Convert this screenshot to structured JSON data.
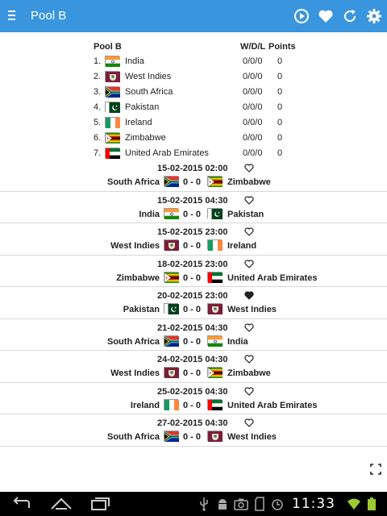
{
  "app_bar": {
    "title": "Pool B",
    "icons": [
      "menu-icon",
      "play-circle-icon",
      "heart-icon",
      "refresh-icon",
      "gear-icon"
    ],
    "color": "#3a95df"
  },
  "standings": {
    "headers": {
      "pool": "Pool B",
      "wdl": "W/D/L",
      "points": "Points"
    },
    "rows": [
      {
        "pos": "1.",
        "team": "India",
        "flag": "india",
        "wdl": "0/0/0",
        "points": "0"
      },
      {
        "pos": "2.",
        "team": "West Indies",
        "flag": "west-indies",
        "wdl": "0/0/0",
        "points": "0"
      },
      {
        "pos": "3.",
        "team": "South Africa",
        "flag": "south-africa",
        "wdl": "0/0/0",
        "points": "0"
      },
      {
        "pos": "4.",
        "team": "Pakistan",
        "flag": "pakistan",
        "wdl": "0/0/0",
        "points": "0"
      },
      {
        "pos": "5.",
        "team": "Ireland",
        "flag": "ireland",
        "wdl": "0/0/0",
        "points": "0"
      },
      {
        "pos": "6.",
        "team": "Zimbabwe",
        "flag": "zimbabwe",
        "wdl": "0/0/0",
        "points": "0"
      },
      {
        "pos": "7.",
        "team": "United Arab Emirates",
        "flag": "uae",
        "wdl": "0/0/0",
        "points": "0"
      }
    ]
  },
  "matches": [
    {
      "datetime": "15-02-2015 02:00",
      "home": "South Africa",
      "home_flag": "south-africa",
      "score": "0 - 0",
      "away": "Zimbabwe",
      "away_flag": "zimbabwe",
      "favorite": false
    },
    {
      "datetime": "15-02-2015 04:30",
      "home": "India",
      "home_flag": "india",
      "score": "0 - 0",
      "away": "Pakistan",
      "away_flag": "pakistan",
      "favorite": false
    },
    {
      "datetime": "15-02-2015 23:00",
      "home": "West Indies",
      "home_flag": "west-indies",
      "score": "0 - 0",
      "away": "Ireland",
      "away_flag": "ireland",
      "favorite": false
    },
    {
      "datetime": "18-02-2015 23:00",
      "home": "Zimbabwe",
      "home_flag": "zimbabwe",
      "score": "0 - 0",
      "away": "United Arab Emirates",
      "away_flag": "uae",
      "favorite": false
    },
    {
      "datetime": "20-02-2015 23:00",
      "home": "Pakistan",
      "home_flag": "pakistan",
      "score": "0 - 0",
      "away": "West Indies",
      "away_flag": "west-indies",
      "favorite": true
    },
    {
      "datetime": "21-02-2015 04:30",
      "home": "South Africa",
      "home_flag": "south-africa",
      "score": "0 - 0",
      "away": "India",
      "away_flag": "india",
      "favorite": false
    },
    {
      "datetime": "24-02-2015 04:30",
      "home": "West Indies",
      "home_flag": "west-indies",
      "score": "0 - 0",
      "away": "Zimbabwe",
      "away_flag": "zimbabwe",
      "favorite": false
    },
    {
      "datetime": "25-02-2015 04:30",
      "home": "Ireland",
      "home_flag": "ireland",
      "score": "0 - 0",
      "away": "United Arab Emirates",
      "away_flag": "uae",
      "favorite": false
    },
    {
      "datetime": "27-02-2015 04:30",
      "home": "South Africa",
      "home_flag": "south-africa",
      "score": "0 - 0",
      "away": "West Indies",
      "away_flag": "west-indies",
      "favorite": false
    }
  ],
  "system_bar": {
    "clock": "11:33",
    "icons": [
      "back-icon",
      "home-icon",
      "recent-apps-icon",
      "usb-icon",
      "android-debug-icon",
      "camera-icon",
      "sd-card-icon",
      "alarm-icon",
      "wifi-icon",
      "battery-icon"
    ]
  }
}
